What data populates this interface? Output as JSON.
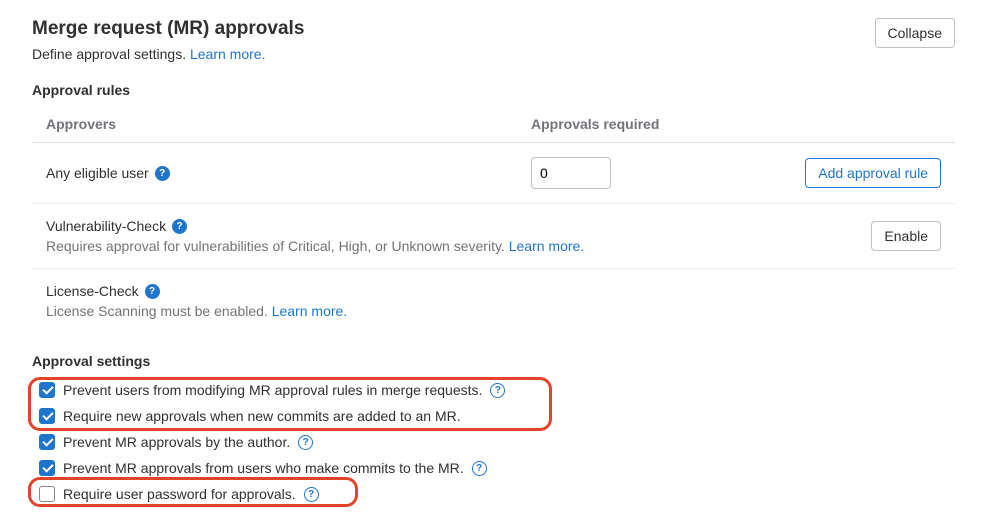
{
  "header": {
    "title": "Merge request (MR) approvals",
    "subtitle": "Define approval settings. ",
    "learn_more": "Learn more.",
    "collapse": "Collapse"
  },
  "rules_section": {
    "title": "Approval rules",
    "col_approvers": "Approvers",
    "col_required": "Approvals required",
    "any_eligible": "Any eligible user",
    "approvals_value": "0",
    "add_rule": "Add approval rule",
    "vuln_check": "Vulnerability-Check",
    "vuln_desc": "Requires approval for vulnerabilities of Critical, High, or Unknown severity. ",
    "vuln_learn": "Learn more.",
    "enable": "Enable",
    "license_check": "License-Check",
    "license_desc": "License Scanning must be enabled. ",
    "license_learn": "Learn more."
  },
  "settings_section": {
    "title": "Approval settings",
    "items": [
      {
        "label": "Prevent users from modifying MR approval rules in merge requests.",
        "checked": true,
        "help": true
      },
      {
        "label": "Require new approvals when new commits are added to an MR.",
        "checked": true,
        "help": false
      },
      {
        "label": "Prevent MR approvals by the author.",
        "checked": true,
        "help": true
      },
      {
        "label": "Prevent MR approvals from users who make commits to the MR.",
        "checked": true,
        "help": true
      },
      {
        "label": "Require user password for approvals.",
        "checked": false,
        "help": true
      }
    ]
  }
}
